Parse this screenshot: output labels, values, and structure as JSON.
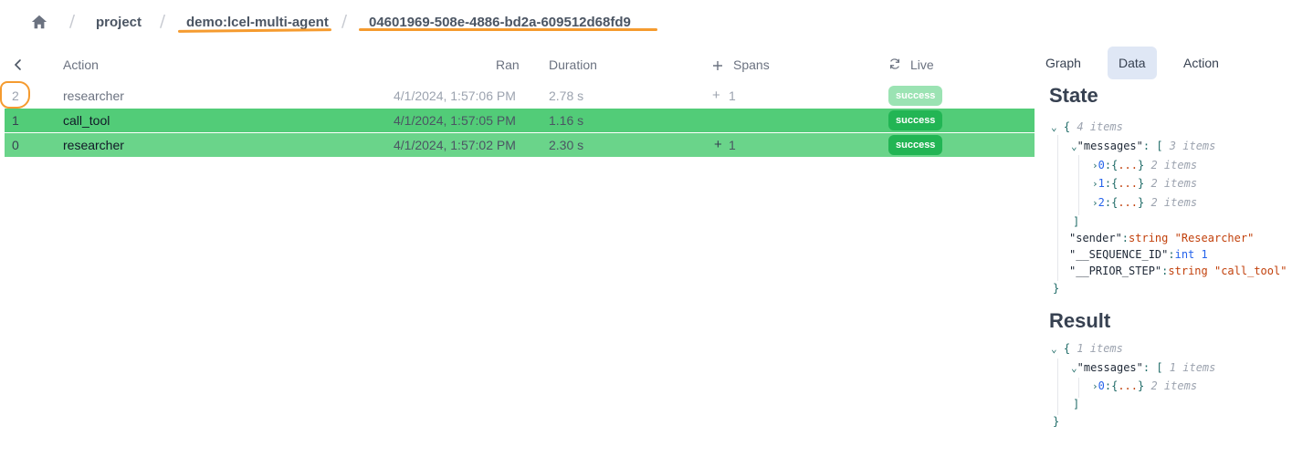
{
  "breadcrumb": {
    "home_icon": "home-icon",
    "project": "project",
    "app": "demo:lcel-multi-agent",
    "partition": "04601969-508e-4886-bd2a-609512d68fd9",
    "separator": "/"
  },
  "table": {
    "headers": {
      "action": "Action",
      "ran": "Ran",
      "duration": "Duration",
      "spans": "Spans",
      "live": "Live"
    },
    "rows": [
      {
        "index": "2",
        "action": "researcher",
        "ran": "4/1/2024, 1:57:06 PM",
        "duration": "2.78 s",
        "spans": "1",
        "status": "success"
      },
      {
        "index": "1",
        "action": "call_tool",
        "ran": "4/1/2024, 1:57:05 PM",
        "duration": "1.16 s",
        "spans": "",
        "status": "success"
      },
      {
        "index": "0",
        "action": "researcher",
        "ran": "4/1/2024, 1:57:02 PM",
        "duration": "2.30 s",
        "spans": "1",
        "status": "success"
      }
    ]
  },
  "tabs": [
    {
      "label": "Graph",
      "active": false
    },
    {
      "label": "Data",
      "active": true
    },
    {
      "label": "Action",
      "active": false
    }
  ],
  "state": {
    "title": "State",
    "count": "4 items",
    "messages_key": "\"messages\"",
    "messages_count": "3 items",
    "message_items": [
      {
        "index": "0",
        "count": "2 items"
      },
      {
        "index": "1",
        "count": "2 items"
      },
      {
        "index": "2",
        "count": "2 items"
      }
    ],
    "sender_key": "\"sender\"",
    "sender_type": "string",
    "sender_value": "\"Researcher\"",
    "seq_key": "\"__SEQUENCE_ID\"",
    "seq_type": "int",
    "seq_value": "1",
    "prior_key": "\"__PRIOR_STEP\"",
    "prior_type": "string",
    "prior_value": "\"call_tool\""
  },
  "result": {
    "title": "Result",
    "count": "1 items",
    "messages_key": "\"messages\"",
    "messages_count": "1 items",
    "message_items": [
      {
        "index": "0",
        "count": "2 items"
      }
    ]
  },
  "colors": {
    "accent_orange": "#f59b2f",
    "row_green": "#52cc78",
    "badge_green": "#22b554",
    "active_tab": "#dfe7f5"
  }
}
